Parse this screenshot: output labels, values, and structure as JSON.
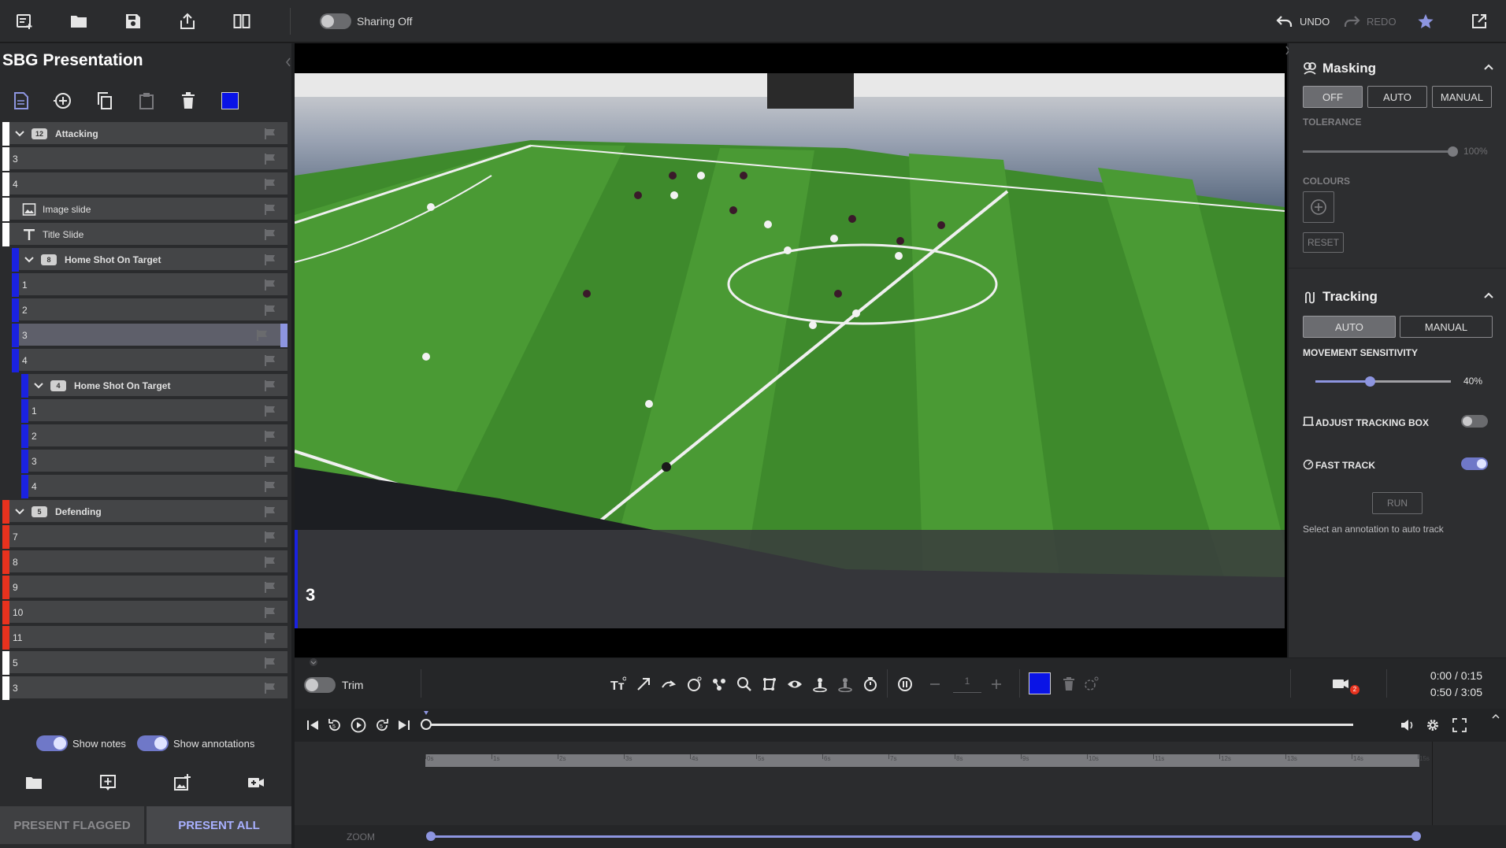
{
  "topbar": {
    "sharing_label": "Sharing Off",
    "undo_label": "UNDO",
    "redo_label": "REDO"
  },
  "left_panel": {
    "title": "SBG Presentation",
    "selected_color": "#0a14e6",
    "slides": [
      {
        "label": "Attacking",
        "type": "group",
        "count": "12",
        "strip": "#ffffff",
        "indent": 0
      },
      {
        "label": "3",
        "type": "slide",
        "strip": "#ffffff",
        "indent": 0
      },
      {
        "label": "4",
        "type": "slide",
        "strip": "#ffffff",
        "indent": 0
      },
      {
        "label": "Image slide",
        "type": "image",
        "strip": "#ffffff",
        "indent": 0
      },
      {
        "label": "Title Slide",
        "type": "title",
        "strip": "#ffffff",
        "indent": 0
      },
      {
        "label": "Home Shot On Target",
        "type": "group",
        "count": "8",
        "strip": "#1a22e0",
        "indent": 1
      },
      {
        "label": "1",
        "type": "slide",
        "strip": "#1a22e0",
        "indent": 1
      },
      {
        "label": "2",
        "type": "slide",
        "strip": "#1a22e0",
        "indent": 1
      },
      {
        "label": "3",
        "type": "slide",
        "strip": "#1a22e0",
        "indent": 1,
        "selected": true
      },
      {
        "label": "4",
        "type": "slide",
        "strip": "#1a22e0",
        "indent": 1
      },
      {
        "label": "Home Shot On Target",
        "type": "group",
        "count": "4",
        "strip": "#1a22e0",
        "indent": 2
      },
      {
        "label": "1",
        "type": "slide",
        "strip": "#1a22e0",
        "indent": 2
      },
      {
        "label": "2",
        "type": "slide",
        "strip": "#1a22e0",
        "indent": 2
      },
      {
        "label": "3",
        "type": "slide",
        "strip": "#1a22e0",
        "indent": 2
      },
      {
        "label": "4",
        "type": "slide",
        "strip": "#1a22e0",
        "indent": 2
      },
      {
        "label": "Defending",
        "type": "group",
        "count": "5",
        "strip": "#e8321e",
        "indent": 0
      },
      {
        "label": "7",
        "type": "slide",
        "strip": "#e8321e",
        "indent": 0
      },
      {
        "label": "8",
        "type": "slide",
        "strip": "#e8321e",
        "indent": 0
      },
      {
        "label": "9",
        "type": "slide",
        "strip": "#e8321e",
        "indent": 0
      },
      {
        "label": "10",
        "type": "slide",
        "strip": "#e8321e",
        "indent": 0
      },
      {
        "label": "11",
        "type": "slide",
        "strip": "#e8321e",
        "indent": 0
      },
      {
        "label": "5",
        "type": "slide",
        "strip": "#ffffff",
        "indent": 0
      },
      {
        "label": "3",
        "type": "slide",
        "strip": "#ffffff",
        "indent": 0
      }
    ],
    "show_notes_label": "Show notes",
    "show_annotations_label": "Show annotations",
    "present_flagged_label": "PRESENT FLAGGED",
    "present_all_label": "PRESENT ALL"
  },
  "video": {
    "slide_number": "3"
  },
  "toolbar": {
    "trim_label": "Trim",
    "stepper_value": "1",
    "annotation_color": "#0a14e6",
    "camera_badge": "2",
    "time_top": "0:00 / 0:15",
    "time_bottom": "0:50 / 3:05"
  },
  "timeline": {
    "ticks": [
      "0s",
      "1s",
      "2s",
      "3s",
      "4s",
      "5s",
      "6s",
      "7s",
      "8s",
      "9s",
      "10s",
      "11s",
      "12s",
      "13s",
      "14s",
      "15s"
    ],
    "zoom_label": "ZOOM"
  },
  "right_panel": {
    "masking": {
      "title": "Masking",
      "modes": [
        "OFF",
        "AUTO",
        "MANUAL"
      ],
      "active_mode": "OFF",
      "tolerance_label": "TOLERANCE",
      "tolerance_value": "100%",
      "tolerance_fraction": 1.0,
      "colours_label": "COLOURS",
      "reset_label": "RESET"
    },
    "tracking": {
      "title": "Tracking",
      "modes": [
        "AUTO",
        "MANUAL"
      ],
      "active_mode": "AUTO",
      "sensitivity_label": "MOVEMENT SENSITIVITY",
      "sensitivity_value": "40%",
      "sensitivity_fraction": 0.4,
      "adjust_box_label": "ADJUST TRACKING BOX",
      "adjust_box_on": false,
      "fast_track_label": "FAST TRACK",
      "fast_track_on": true,
      "run_label": "RUN",
      "hint": "Select an annotation to auto track"
    }
  }
}
